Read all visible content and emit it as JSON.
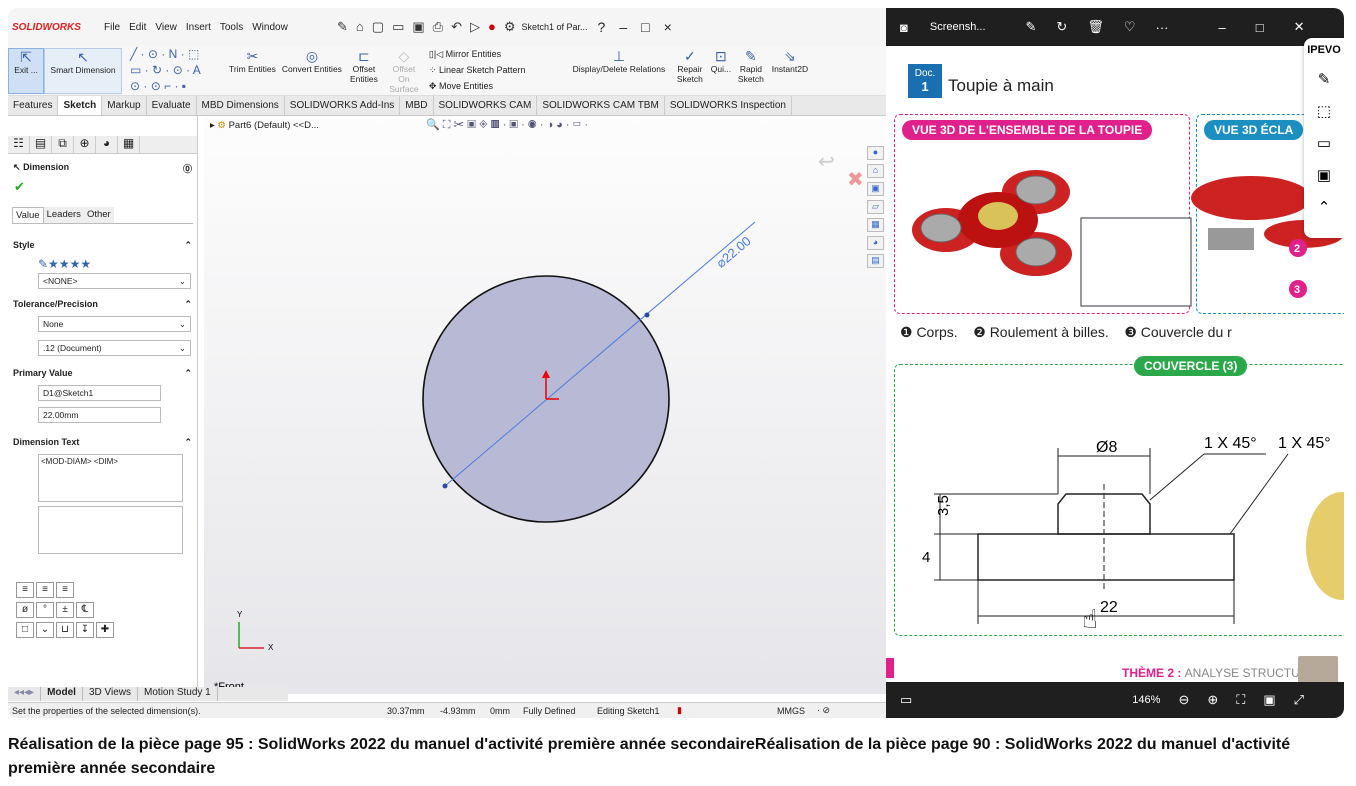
{
  "sw": {
    "logo": "SOLIDWORKS",
    "menu": [
      "File",
      "Edit",
      "View",
      "Insert",
      "Tools",
      "Window"
    ],
    "doc_title": "Sketch1 of Par...",
    "ribbon": {
      "exit": "Exit ...",
      "smart": "Smart Dimension",
      "trim": "Trim Entities",
      "convert": "Convert Entities",
      "offset": "Offset Entities",
      "offset_surface": "Offset On Surface",
      "mirror": "Mirror Entities",
      "linear": "Linear Sketch Pattern",
      "move": "Move Entities",
      "display": "Display/Delete Relations",
      "repair": "Repair Sketch",
      "quick": "Qui...",
      "rapid": "Rapid Sketch",
      "instant": "Instant2D"
    },
    "tabs": [
      "Features",
      "Sketch",
      "Markup",
      "Evaluate",
      "MBD Dimensions",
      "SOLIDWORKS Add-Ins",
      "MBD",
      "SOLIDWORKS CAM",
      "SOLIDWORKS CAM TBM",
      "SOLIDWORKS Inspection"
    ],
    "pm": {
      "title": "Dimension",
      "subtabs": [
        "Value",
        "Leaders",
        "Other"
      ],
      "style": "Style",
      "style_value": "<NONE>",
      "tolerance": "Tolerance/Precision",
      "tol_value": "None",
      "precision": ".12 (Document)",
      "primary": "Primary Value",
      "dim_name": "D1@Sketch1",
      "dim_value": "22.00mm",
      "dim_text": "Dimension Text",
      "dim_text_value": "<MOD-DIAM> <DIM>"
    },
    "tree_item": "Part6 (Default) <<D...",
    "dimension_label": "⌀22.00",
    "view_label": "*Front",
    "axis_y": "Y",
    "axis_x": "X",
    "bottom_tabs": [
      "Model",
      "3D Views",
      "Motion Study 1"
    ],
    "status": {
      "hint": "Set the properties of the selected dimension(s).",
      "x": "30.37mm",
      "y": "-4.93mm",
      "z": "0mm",
      "state": "Fully Defined",
      "editing": "Editing Sketch1",
      "units": "MMGS"
    }
  },
  "viewer": {
    "app_title": "Screensh...",
    "zoom": "146%",
    "ipevo": "IPEVO",
    "doc_tag": "Doc.",
    "doc_num": "1",
    "doc_title": "Toupie à main",
    "pill_left": "VUE 3D DE L'ENSEMBLE DE LA TOUPIE",
    "pill_right": "VUE 3D ÉCLA",
    "legend": [
      "❶ Corps.",
      "❷ Roulement à billes.",
      "❸ Couvercle du r"
    ],
    "couvercle": "COUVERCLE (3)",
    "dims": {
      "d8": "Ø8",
      "c1": "1 X 45°",
      "c2": "1 X 45°",
      "h35": "3,5",
      "h4": "4",
      "d22": "22"
    },
    "theme": "THÈME 2 : ",
    "theme_rest": "ANALYSE STRUCTUR",
    "num2": "2",
    "num3": "3"
  },
  "caption": "Réalisation de la pièce page 95 : SolidWorks 2022 du manuel d'activité première année secondaireRéalisation de la pièce page 90 : SolidWorks 2022 du manuel d'activité première année secondaire"
}
